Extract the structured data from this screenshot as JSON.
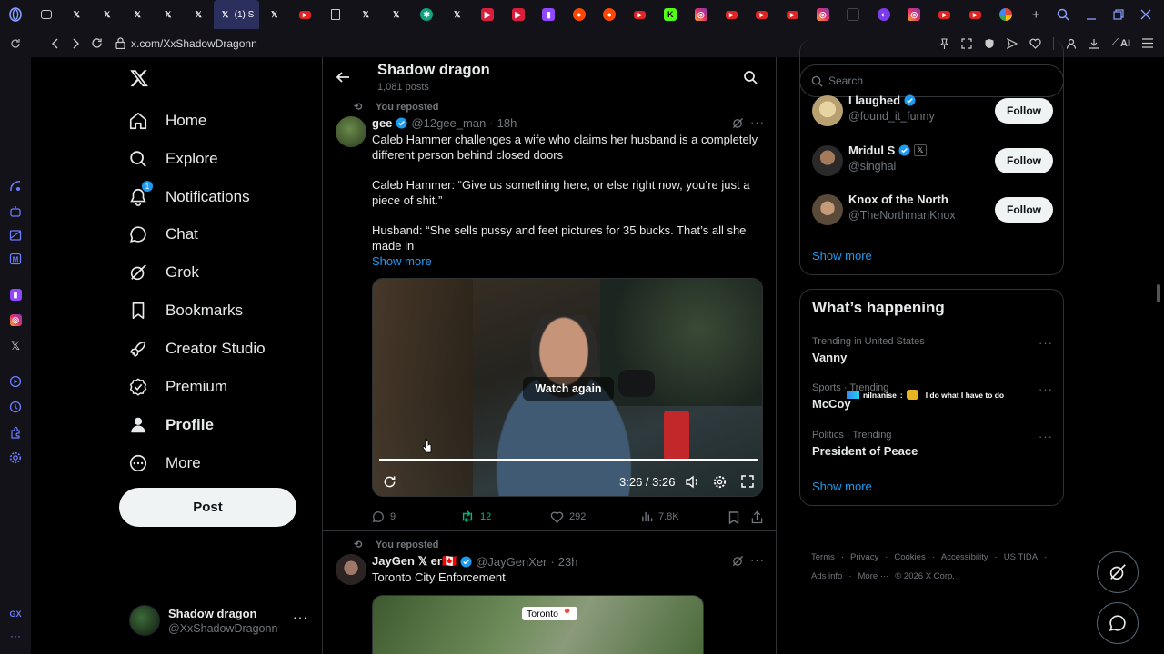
{
  "browser": {
    "active_tab_label": "(1) S",
    "url": "x.com/XxShadowDragonn",
    "ai_label": "AI",
    "gx_label": "GX"
  },
  "nav": {
    "items": [
      {
        "label": "Home"
      },
      {
        "label": "Explore"
      },
      {
        "label": "Notifications",
        "badge": "1"
      },
      {
        "label": "Chat"
      },
      {
        "label": "Grok"
      },
      {
        "label": "Bookmarks"
      },
      {
        "label": "Creator Studio"
      },
      {
        "label": "Premium"
      },
      {
        "label": "Profile"
      },
      {
        "label": "More"
      }
    ],
    "post_label": "Post",
    "account": {
      "name": "Shadow dragon",
      "handle": "@XxShadowDragonn"
    }
  },
  "profile_header": {
    "name": "Shadow dragon",
    "posts": "1,081 posts"
  },
  "tweets": [
    {
      "repost_label": "You reposted",
      "name": "gee",
      "handle": "@12gee_man",
      "time": "18h",
      "text1": "Caleb Hammer challenges a wife who claims her husband is a completely different person behind closed doors",
      "text2": "Caleb Hammer: “Give us something here, or else right now, you’re just a piece of shit.”",
      "text3": "Husband: “She sells pussy and feet pictures for 35 bucks. That’s all she made in",
      "show_more": "Show more",
      "video": {
        "overlay": "Watch again",
        "time": "3:26 / 3:26",
        "progress": 1.0
      },
      "replies": "9",
      "reposts": "12",
      "likes": "292",
      "views": "7.8K"
    },
    {
      "repost_label": "You reposted",
      "name": "JayGen 𝕏 er🇨🇦",
      "handle": "@JayGenXer",
      "time": "23h",
      "text1": "Toronto City Enforcement",
      "map_label": "Toronto 📍"
    }
  ],
  "search": {
    "placeholder": "Search"
  },
  "who_to_follow": {
    "users": [
      {
        "name": "I laughed",
        "handle": "@found_it_funny"
      },
      {
        "name": "Mridul S",
        "handle": "@singhai"
      },
      {
        "name": "Knox of the North",
        "handle": "@TheNorthmanKnox"
      }
    ],
    "follow_label": "Follow",
    "show_more": "Show more"
  },
  "happening": {
    "title": "What’s happening",
    "trends": [
      {
        "context": "Trending in United States",
        "name": "Vanny"
      },
      {
        "context": "Sports · Trending",
        "name": "McCoy"
      },
      {
        "context": "Politics · Trending",
        "name": "President of Peace"
      }
    ],
    "overlay_user": "nilnanise",
    "overlay_text": "I do what I have to do",
    "show_more": "Show more"
  },
  "footer": {
    "links": [
      "Terms",
      "Privacy",
      "Cookies",
      "Accessibility",
      "US TIDA",
      "Ads info",
      "More ···"
    ],
    "copyright": "© 2026 X Corp."
  },
  "colors": {
    "accent": "#1d9bf0",
    "repost_green": "#00ba7c",
    "background": "#000000"
  }
}
